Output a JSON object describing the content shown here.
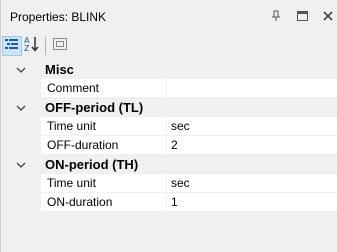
{
  "window": {
    "title": "Properties: BLINK",
    "pin_icon": "pin-icon",
    "maximize_icon": "maximize-icon",
    "close_icon": "close-icon"
  },
  "toolbar": {
    "buttons": [
      {
        "icon": "categorized-icon",
        "active": true
      },
      {
        "icon": "alphabetical-sort-icon",
        "active": false
      },
      {
        "icon": "property-pages-icon",
        "active": false
      }
    ]
  },
  "grid": {
    "categories": [
      {
        "label": "Misc",
        "expanded": true,
        "properties": [
          {
            "name": "Comment",
            "value": ""
          }
        ]
      },
      {
        "label": "OFF-period (TL)",
        "expanded": true,
        "properties": [
          {
            "name": "Time unit",
            "value": "sec"
          },
          {
            "name": "OFF-duration",
            "value": "2"
          }
        ]
      },
      {
        "label": "ON-period (TH)",
        "expanded": true,
        "properties": [
          {
            "name": "Time unit",
            "value": "sec"
          },
          {
            "name": "ON-duration",
            "value": "1"
          }
        ]
      }
    ]
  }
}
